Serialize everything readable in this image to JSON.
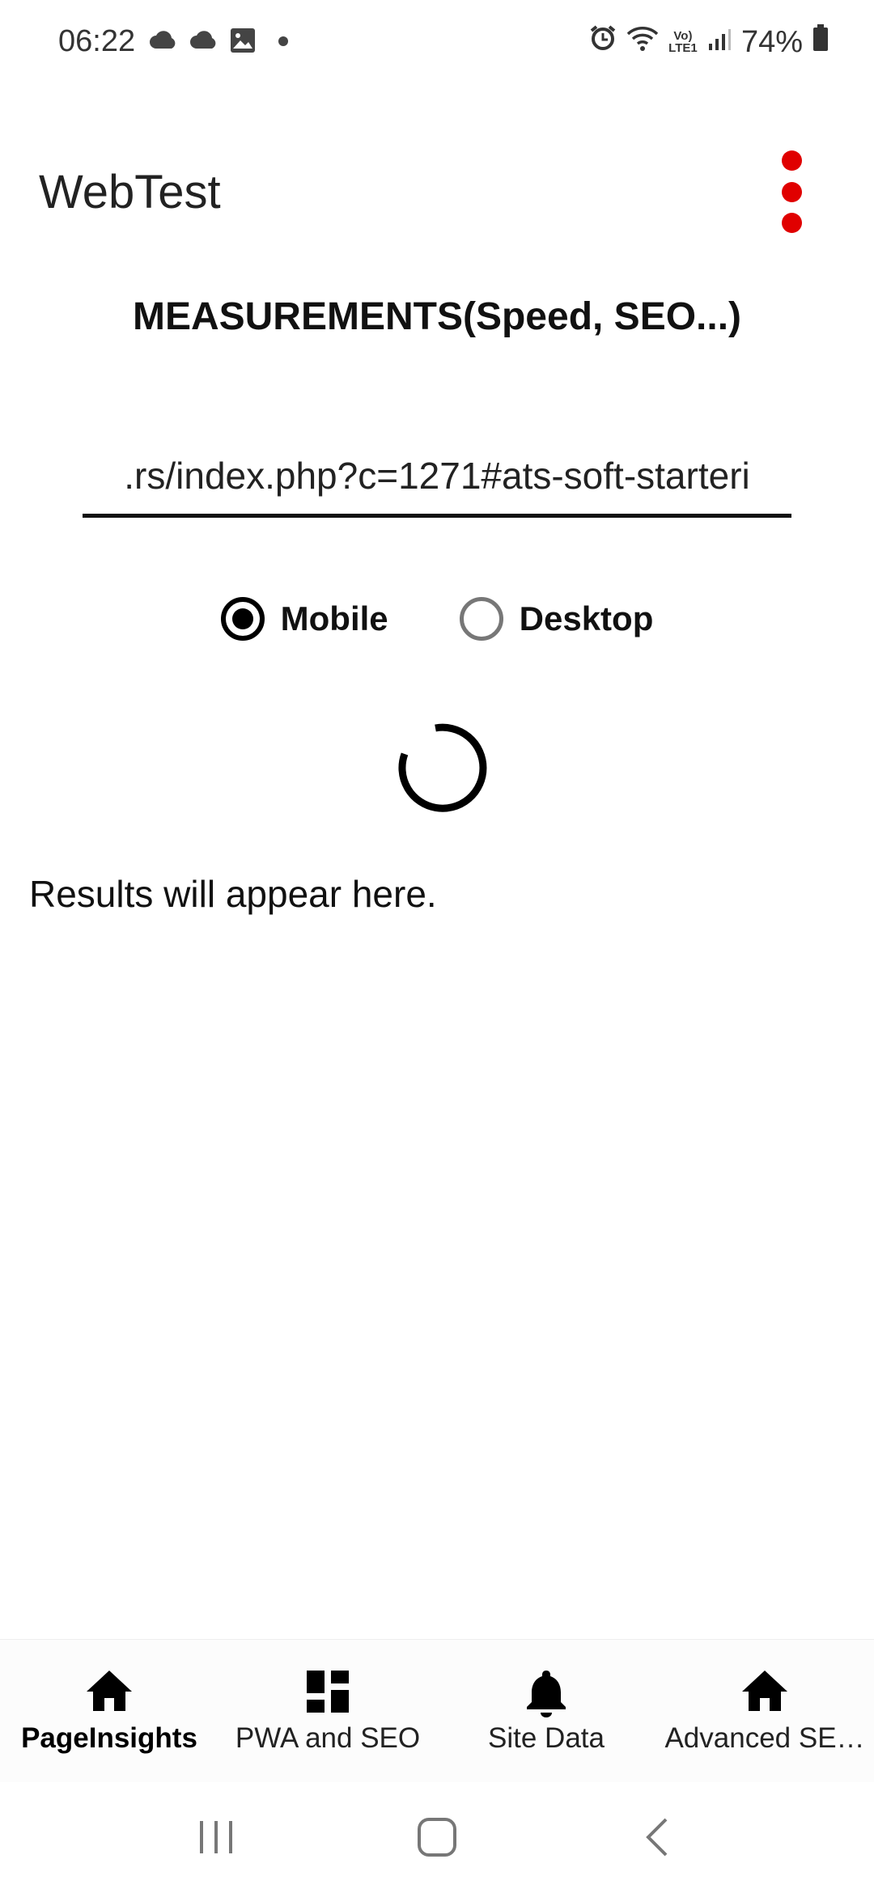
{
  "status_bar": {
    "time": "06:22",
    "left_icons": [
      "cloud-icon",
      "cloud-icon",
      "image-icon",
      "dot-icon"
    ],
    "right_icons": [
      "alarm-icon",
      "wifi-icon",
      "volte-icon",
      "signal-icon",
      "battery-icon"
    ],
    "volte_label": "Vo) LTE1",
    "battery": "74%"
  },
  "app_bar": {
    "title": "WebTest",
    "menu_icon": "overflow-menu-icon",
    "menu_color": "#e00000"
  },
  "heading": "MEASUREMENTS(Speed, SEO...)",
  "url_input": {
    "value": ".rs/index.php?c=1271#ats-soft-starteri"
  },
  "device_options": [
    {
      "label": "Mobile",
      "selected": true
    },
    {
      "label": "Desktop",
      "selected": false
    }
  ],
  "results_placeholder": "Results will appear here.",
  "bottom_nav": {
    "items": [
      {
        "label": "PageInsights",
        "icon": "home-icon",
        "active": true
      },
      {
        "label": "PWA and SEO",
        "icon": "dashboard-icon",
        "active": false
      },
      {
        "label": "Site Data",
        "icon": "bell-icon",
        "active": false
      },
      {
        "label": "Advanced SE…",
        "icon": "home-icon",
        "active": false
      }
    ]
  },
  "system_nav": [
    "recents-icon",
    "home-button-icon",
    "back-icon"
  ]
}
